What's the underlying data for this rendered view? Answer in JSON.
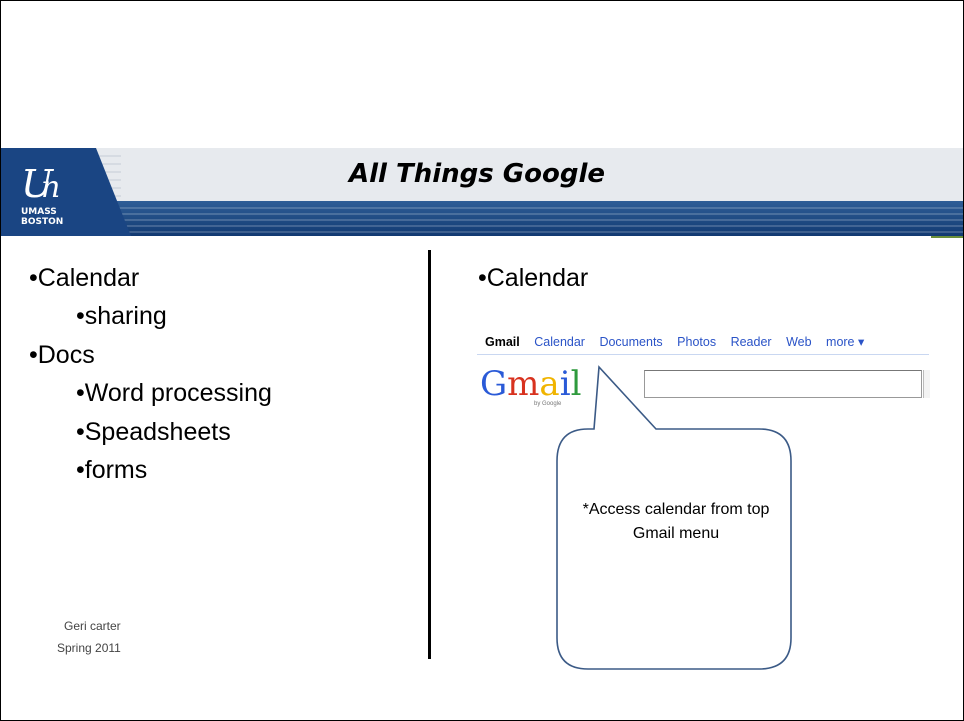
{
  "slide": {
    "title": "All Things Google",
    "logo": {
      "line1": "UMASS",
      "line2": "BOSTON"
    },
    "left_list": [
      {
        "text": "•Calendar",
        "level": 0
      },
      {
        "text": "•sharing",
        "level": 1
      },
      {
        "text": "•Docs",
        "level": 0
      },
      {
        "text": "•Word processing",
        "level": 1
      },
      {
        "text": "•Speadsheets",
        "level": 1
      },
      {
        "text": "•forms",
        "level": 1
      }
    ],
    "footer": {
      "author": "Geri carter",
      "term": "Spring 2011"
    },
    "right_heading": "•Calendar",
    "gmail": {
      "nav": [
        "Gmail",
        "Calendar",
        "Documents",
        "Photos",
        "Reader",
        "Web",
        "more ▾"
      ],
      "logo_text": "Gmail",
      "logo_byline": "by Google"
    },
    "callout_text": "*Access calendar from top Gmail menu",
    "colors": {
      "banner_blue": "#1f4a86",
      "banner_light": "#e7eaee",
      "callout_border": "#3b5a86",
      "link_blue": "#2a53c7"
    }
  }
}
